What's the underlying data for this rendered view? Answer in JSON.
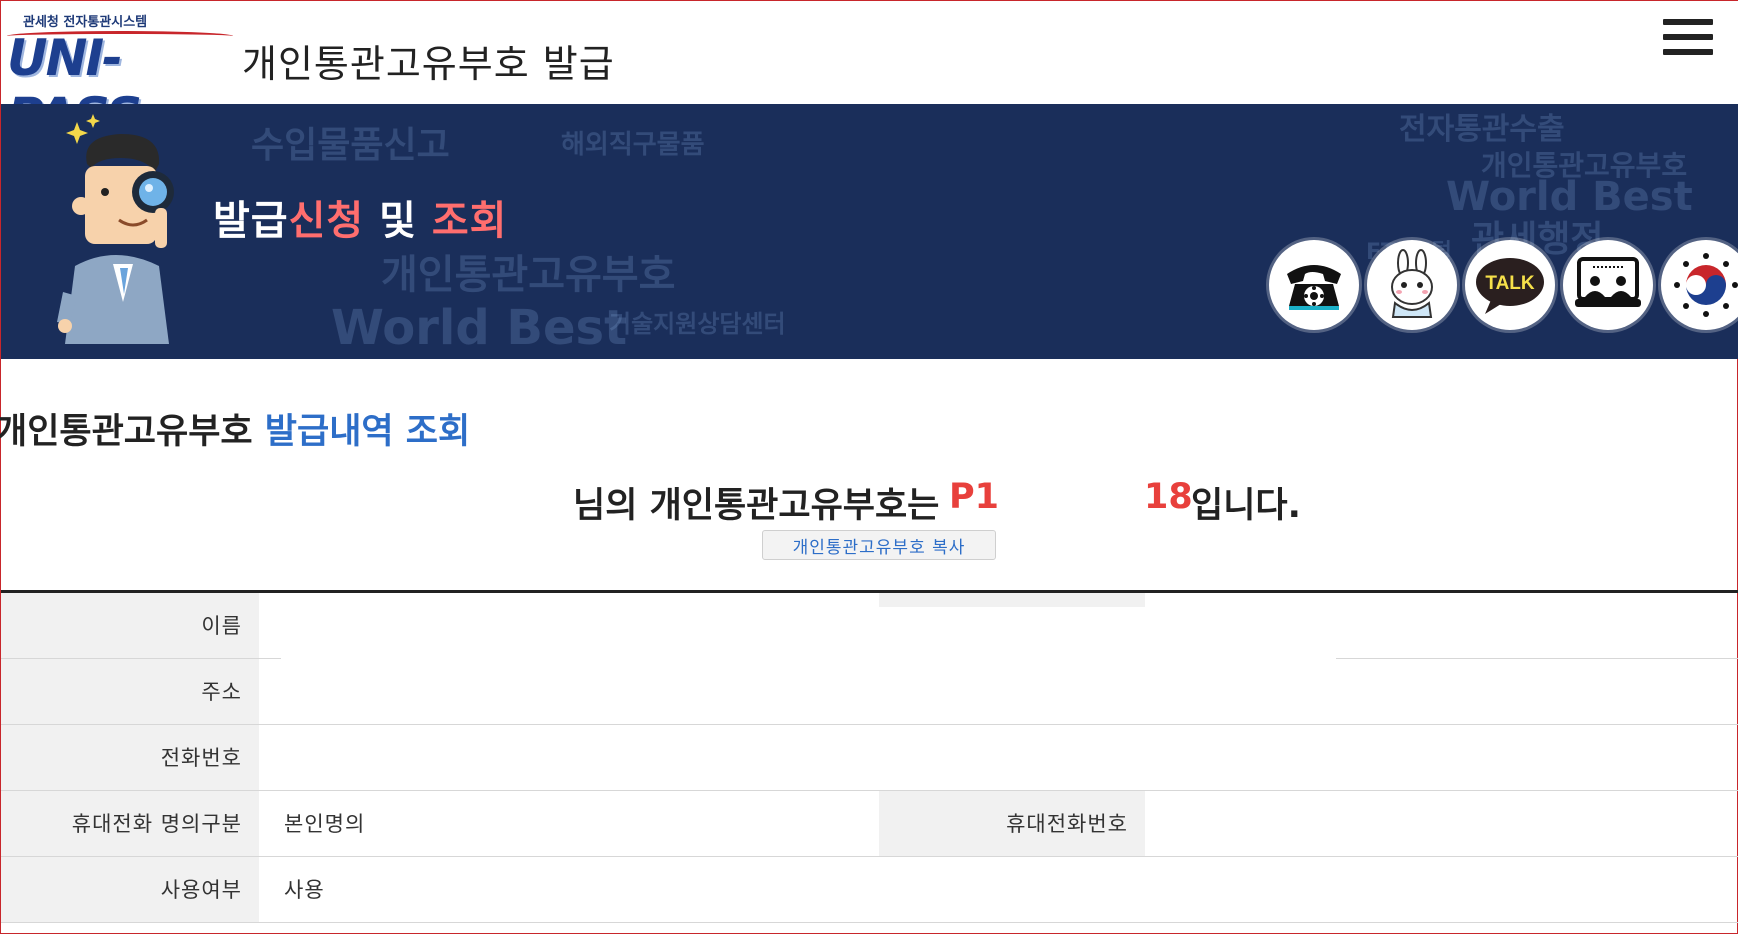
{
  "header": {
    "logo_org": "관세청 전자통관시스템",
    "logo_word": "UNI-PASS",
    "title": "개인통관고유부호 발급",
    "menu_icon": "hamburger-menu-icon"
  },
  "banner": {
    "title_part1": "발급",
    "title_part2": "신청",
    "title_part3": " 및 ",
    "title_part4": "조회",
    "highlight_color": "#ff6e6e",
    "background_color": "#1a2e5a",
    "background_words": [
      "수입물품신고",
      "해외직구물품",
      "개인통관고유부호",
      "World Best",
      "기술지원상담센터",
      "전자통관수출",
      "FTA포털",
      "관세행정"
    ],
    "buttons": [
      {
        "name": "phone",
        "icon": "telephone-icon"
      },
      {
        "name": "chatbot",
        "icon": "chatbot-rabbit-icon"
      },
      {
        "name": "kakaotalk",
        "icon": "kakaotalk-icon",
        "label": "TALK"
      },
      {
        "name": "remote",
        "icon": "remote-support-icon"
      },
      {
        "name": "government",
        "icon": "government-emblem-icon"
      }
    ]
  },
  "section": {
    "title_black": "개인통관고유부호 ",
    "title_blue": "발급내역 조회"
  },
  "result": {
    "prefix": "님의 개인통관고유부호는",
    "code_start": "P1",
    "code_end": "18",
    "suffix": "입니다.",
    "copy_button": "개인통관고유부호 복사"
  },
  "table": {
    "rows": [
      {
        "label": "이름",
        "value": ""
      },
      {
        "label": "주소",
        "value": ""
      },
      {
        "label": "전화번호",
        "value": ""
      },
      {
        "label": "휴대전화 명의구분",
        "value": "본인명의",
        "label2": "휴대전화번호",
        "value2": ""
      },
      {
        "label": "사용여부",
        "value": "사용"
      }
    ]
  }
}
